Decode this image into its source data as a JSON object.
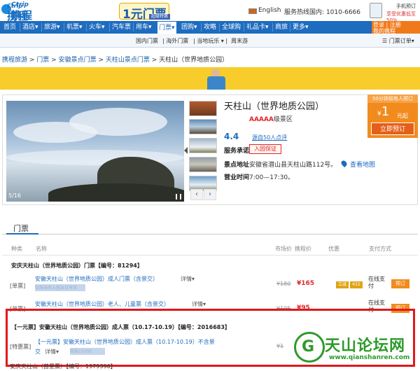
{
  "header": {
    "logo_top": "Ctrip",
    "logo_main": "携程",
    "language": "English",
    "service_label": "服务热线",
    "service_region": "国内:",
    "service_phone": "1010-6666",
    "promo_title": "手机预订",
    "promo_text": "享受优惠低至",
    "promo_discount": "50%"
  },
  "nav": {
    "items": [
      "首页",
      "酒店",
      "旅游",
      "机票",
      "火车",
      "汽车票",
      "用车",
      "门票",
      "团购",
      "攻略",
      "全球购",
      "礼品卡",
      "商旅",
      "更多"
    ],
    "active": "门票",
    "login_line1": "登录",
    "login_line2": "注册",
    "login_line3": "我的携程"
  },
  "subnav": {
    "items": [
      "国内门票",
      "海外门票",
      "当地玩乐",
      "周末游"
    ],
    "ticket_order": "门票订单"
  },
  "breadcrumb": {
    "items": [
      "携程旅游",
      "门票",
      "安徽景点门票",
      "天柱山景点门票"
    ],
    "current": "天柱山（世界地质公园）"
  },
  "banner": {
    "logo_top": "Ctrip",
    "logo_main": "携程",
    "headline": "1元门票",
    "tag": "超级特惠"
  },
  "attraction": {
    "title": "天柱山（世界地质公园）",
    "level_mark": "AAAAA",
    "level_text": "级景区",
    "score": "4.4",
    "review_text": "源自50人点评",
    "photo_counter": "5/16",
    "service_label": "服务承诺",
    "guarantee": "入园保证",
    "addr_label": "景点地址",
    "address": "安徽省潜山县天柱山路112号。",
    "map_link": "查看地图",
    "hours_label": "营业时间",
    "hours": "7:00—17:30。"
  },
  "pricebox": {
    "top": "50分钟前有人预订",
    "currency": "¥",
    "amount": "1",
    "suffix": "元起",
    "book_button": "立即预订"
  },
  "tickets": {
    "section_title": "门票",
    "columns": [
      "种类",
      "名称",
      "市场价",
      "携程价",
      "优惠",
      "支付方式"
    ],
    "group1_title": "安庆天柱山（世界地质公园）门票【编号：81294】",
    "rows": [
      {
        "kind": "[单票]",
        "name": "安徽天柱山（世界地质公园）成人门票（含景交）",
        "detail": "详情",
        "blur": "仅限当天入园当日有效",
        "market": "¥180",
        "price": "¥165",
        "chip1": "立减",
        "chip2": "¥15",
        "pay": "在线支付",
        "button": "预订"
      },
      {
        "kind": "[单票]",
        "name": "安徽天柱山（世界地质公园）老人、儿童票（含景交）",
        "detail": "详情",
        "blur": "仅限当天入园",
        "market": "¥105",
        "price": "¥95",
        "pay": "在线支付",
        "button": "预订"
      }
    ],
    "group2_title": "【一元票】安徽天柱山（世界地质公园）成人票（10.17-10.19）【编号：2016683】",
    "special": {
      "kind": "[特惠票]",
      "name": "【一元票】安徽天柱山（世界地质公园）成人票（10.17-10.19）不含景",
      "name2": "交",
      "detail": "详情",
      "blur": "限购15000",
      "market": "¥1"
    },
    "last_line": "安庆天柱山（首星票）【编号：1979396】"
  },
  "watermark": {
    "brand": "天山论坛网",
    "url": "www.qianshanren.com"
  }
}
